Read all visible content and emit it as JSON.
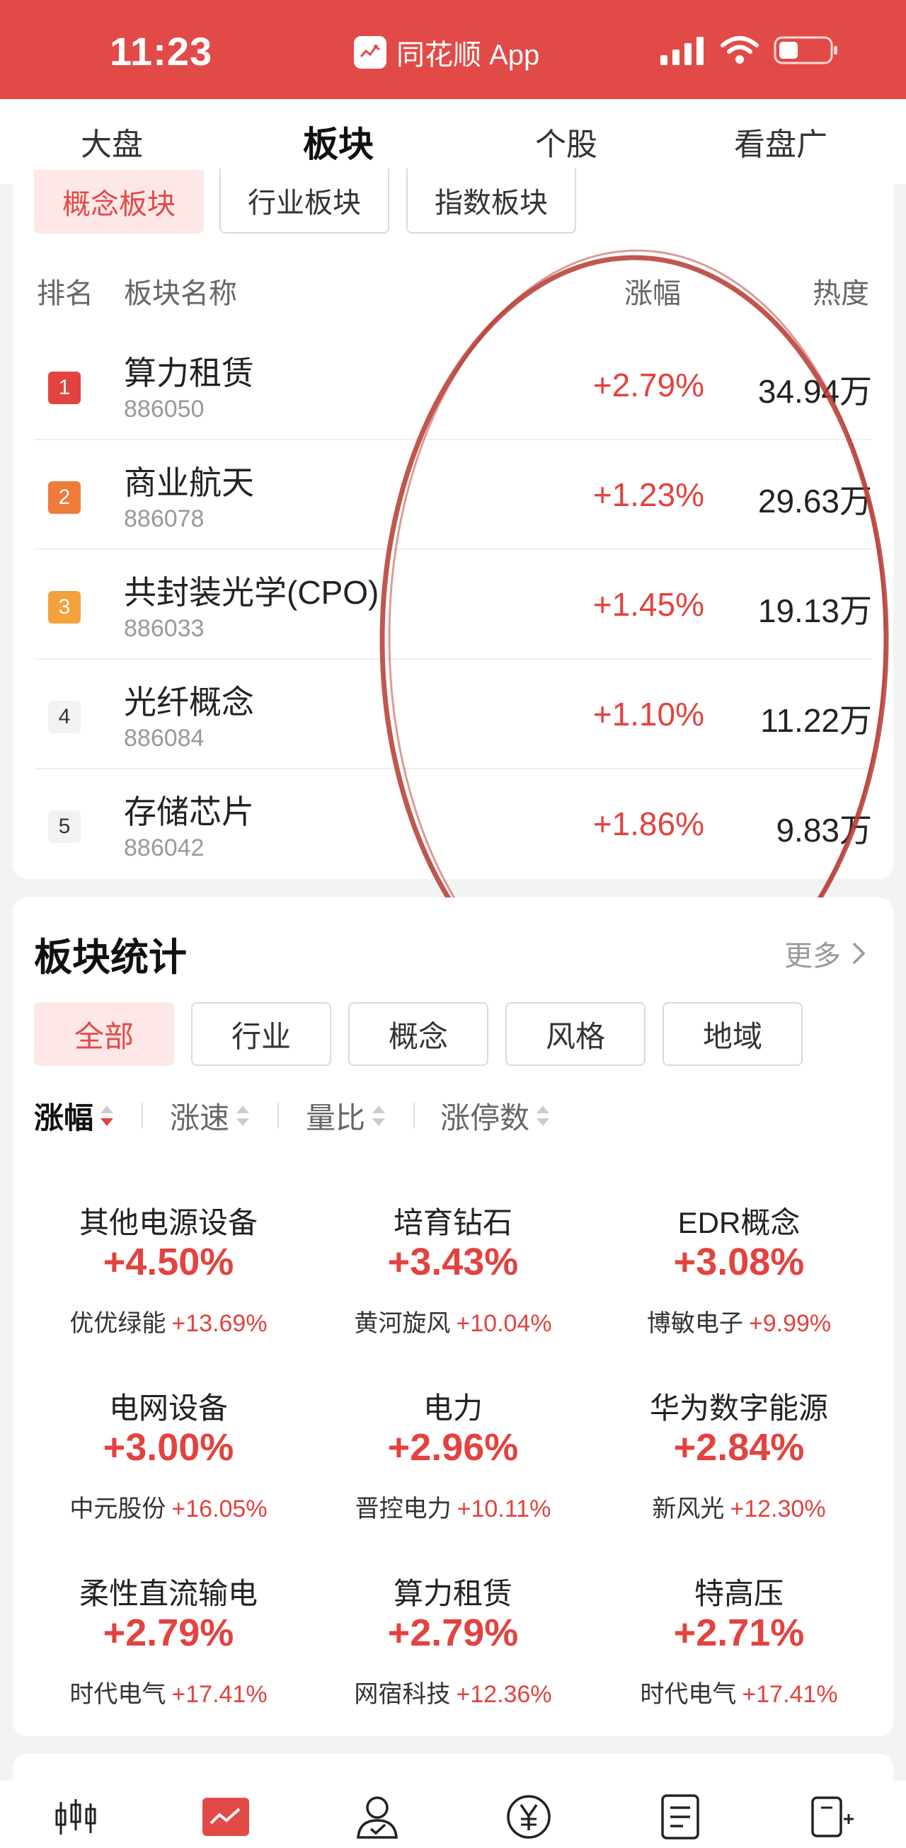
{
  "status_bar": {
    "time": "11:23",
    "app_name": "同花顺 App",
    "icons": [
      "signal-icon",
      "wifi-icon",
      "battery-icon"
    ]
  },
  "top_nav": {
    "tabs": [
      {
        "label": "大盘"
      },
      {
        "label": "板块",
        "active": true
      },
      {
        "label": "个股"
      },
      {
        "label": "看盘广场"
      }
    ]
  },
  "board_ranking": {
    "chips": [
      {
        "label": "概念板块",
        "active": true
      },
      {
        "label": "行业板块"
      },
      {
        "label": "指数板块"
      }
    ],
    "headers": {
      "rank": "排名",
      "name": "板块名称",
      "change": "涨幅",
      "heat": "热度"
    },
    "rows": [
      {
        "rank": "1",
        "name": "算力租赁",
        "code": "886050",
        "change": "+2.79%",
        "heat": "34.94万",
        "rank_color": "#e2433f"
      },
      {
        "rank": "2",
        "name": "商业航天",
        "code": "886078",
        "change": "+1.23%",
        "heat": "29.63万",
        "rank_color": "#ef7a3a"
      },
      {
        "rank": "3",
        "name": "共封装光学(CPO)",
        "code": "886033",
        "change": "+1.45%",
        "heat": "19.13万",
        "rank_color": "#f3a23e"
      },
      {
        "rank": "4",
        "name": "光纤概念",
        "code": "886084",
        "change": "+1.10%",
        "heat": "11.22万",
        "rank_color": "#f2f2f2"
      },
      {
        "rank": "5",
        "name": "存储芯片",
        "code": "886042",
        "change": "+1.86%",
        "heat": "9.83万",
        "rank_color": "#f2f2f2"
      }
    ]
  },
  "board_stats": {
    "title": "板块统计",
    "more": "更多",
    "filters": [
      {
        "label": "全部",
        "active": true
      },
      {
        "label": "行业"
      },
      {
        "label": "概念"
      },
      {
        "label": "风格"
      },
      {
        "label": "地域"
      }
    ],
    "sorts": [
      {
        "label": "涨幅",
        "active": true
      },
      {
        "label": "涨速"
      },
      {
        "label": "量比"
      },
      {
        "label": "涨停数"
      }
    ],
    "cells": [
      {
        "name": "其他电源设备",
        "pct": "+4.50%",
        "stock": "优优绿能",
        "stock_pct": "+13.69%"
      },
      {
        "name": "培育钻石",
        "pct": "+3.43%",
        "stock": "黄河旋风",
        "stock_pct": "+10.04%"
      },
      {
        "name": "EDR概念",
        "pct": "+3.08%",
        "stock": "博敏电子",
        "stock_pct": "+9.99%"
      },
      {
        "name": "电网设备",
        "pct": "+3.00%",
        "stock": "中元股份",
        "stock_pct": "+16.05%"
      },
      {
        "name": "电力",
        "pct": "+2.96%",
        "stock": "晋控电力",
        "stock_pct": "+10.11%"
      },
      {
        "name": "华为数字能源",
        "pct": "+2.84%",
        "stock": "新风光",
        "stock_pct": "+12.30%"
      },
      {
        "name": "柔性直流输电",
        "pct": "+2.79%",
        "stock": "时代电气",
        "stock_pct": "+17.41%"
      },
      {
        "name": "算力租赁",
        "pct": "+2.79%",
        "stock": "网宿科技",
        "stock_pct": "+12.36%"
      },
      {
        "name": "特高压",
        "pct": "+2.71%",
        "stock": "时代电气",
        "stock_pct": "+17.41%"
      }
    ]
  },
  "bottom_nav": {
    "icons": [
      "candlestick-icon",
      "chart-icon",
      "user-icon",
      "yuan-icon",
      "document-icon",
      "trade-icon"
    ]
  },
  "colors": {
    "brand_red": "#e24a47",
    "rise_red": "#e2433f",
    "annotation_circle": "#b53a30"
  }
}
